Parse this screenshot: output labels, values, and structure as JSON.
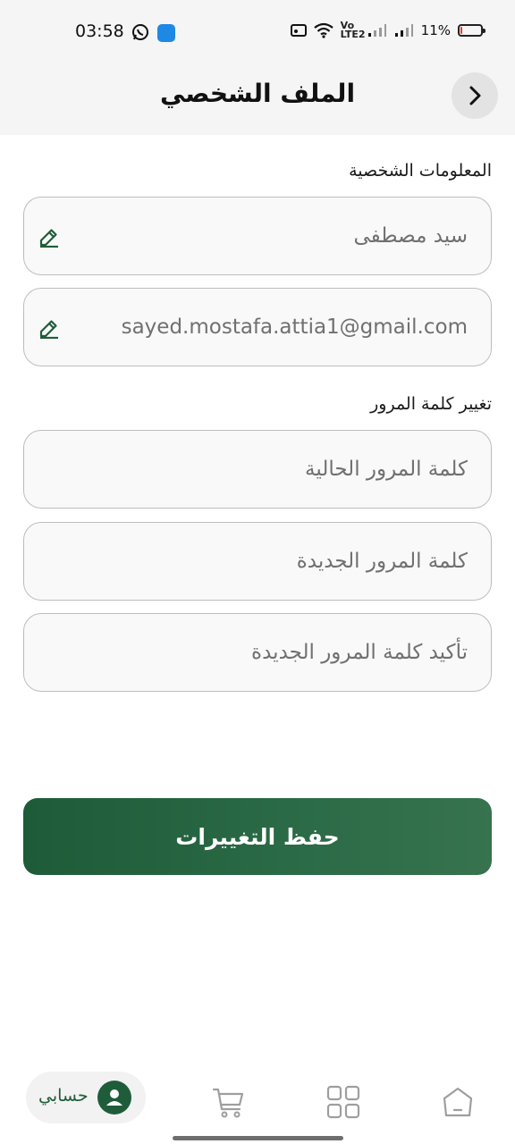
{
  "status_bar": {
    "time": "03:58",
    "battery_text": "11%",
    "battery_level": 0.11,
    "signal_label": "Vo LTE2",
    "battery_color": "#e53935"
  },
  "header": {
    "title": "الملف الشخصي",
    "back_icon": "chevron-right-icon"
  },
  "personal_info": {
    "label": "المعلومات الشخصية",
    "name_value": "سيد مصطفى",
    "email_value": "sayed.mostafa.attia1@gmail.com",
    "edit_icon": "pencil-icon"
  },
  "change_password": {
    "label": "تغيير كلمة المرور",
    "current_placeholder": "كلمة المرور الحالية",
    "new_placeholder": "كلمة المرور الجديدة",
    "confirm_placeholder": "تأكيد كلمة المرور الجديدة"
  },
  "save_button": {
    "label": "حفظ التغييرات",
    "color": "#1f5d3a"
  },
  "bottom_nav": {
    "account_label": "حسابي",
    "items": [
      "account-icon",
      "cart-icon",
      "grid-icon",
      "home-icon"
    ]
  }
}
